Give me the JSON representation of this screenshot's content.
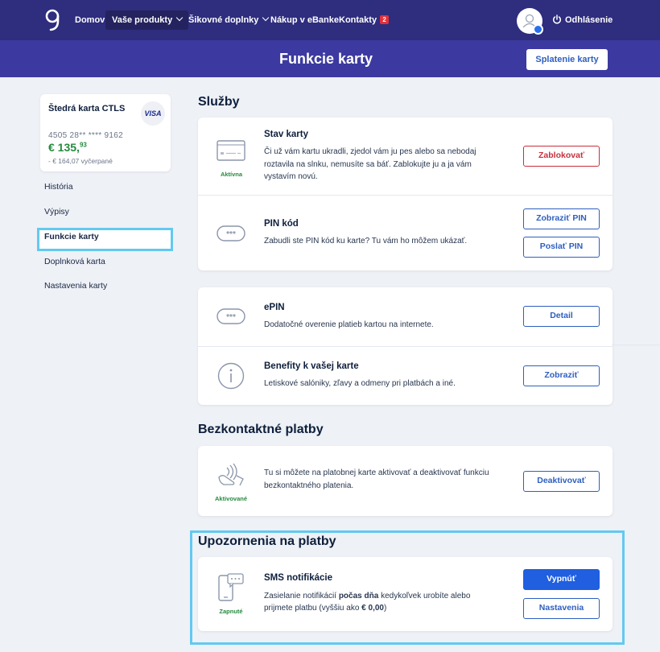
{
  "nav": {
    "items": [
      {
        "label": "Domov"
      },
      {
        "label": "Vaše produkty"
      },
      {
        "label": "Šikovné doplnky"
      },
      {
        "label": "Nákup v eBanke"
      },
      {
        "label": "Kontakty",
        "badge": "2"
      }
    ],
    "logout": "Odhlásenie"
  },
  "header": {
    "title": "Funkcie karty",
    "action": "Splatenie karty"
  },
  "card": {
    "name": "Štedrá karta CTLS",
    "brand": "VISA",
    "number": "4505 28** **** 9162",
    "amount_main": "€ 135,",
    "amount_cents": "93",
    "spent": "- € 164,07 vyčerpané"
  },
  "sidebar": {
    "items": [
      {
        "label": "História"
      },
      {
        "label": "Výpisy"
      },
      {
        "label": "Funkcie karty"
      },
      {
        "label": "Doplnková karta"
      },
      {
        "label": "Nastavenia karty"
      }
    ]
  },
  "sections": {
    "sluzby": "Služby",
    "bezkontaktne": "Bezkontaktné platby",
    "upozornenia": "Upozornenia na platby"
  },
  "rows": {
    "stav": {
      "title": "Stav karty",
      "desc1": "Či už vám kartu ukradli, zjedol vám ju pes alebo sa nebodaj",
      "desc2": "roztavila na slnku, nemusíte sa báť. Zablokujte ju a ja vám",
      "desc3": "vystavím novú.",
      "status": "Aktívna",
      "button": "Zablokovať"
    },
    "pin": {
      "title": "PIN kód",
      "desc": "Zabudli ste PIN kód ku karte? Tu vám ho môžem ukázať.",
      "button1": "Zobraziť PIN",
      "button2": "Poslať PIN"
    },
    "epin": {
      "title": "ePIN",
      "desc": "Dodatočné overenie platieb kartou na internete.",
      "button": "Detail"
    },
    "benefity": {
      "title": "Benefity k vašej karte",
      "desc": "Letiskové salóniky, zľavy a odmeny pri platbách a iné.",
      "button": "Zobraziť"
    },
    "contactless": {
      "desc1": "Tu si môžete na platobnej karte aktivovať a deaktivovať funkciu",
      "desc2": "bezkontaktného platenia.",
      "status": "Aktivované",
      "button": "Deaktivovať"
    },
    "sms": {
      "title": "SMS notifikácie",
      "desc1a": "Zasielanie notifikácií ",
      "desc1b": "počas dňa",
      "desc1c": " kedykoľvek urobíte alebo",
      "desc2a": "prijmete platbu (vyššiu ako ",
      "desc2b": "€ 0,00",
      "desc2c": ")",
      "status": "Zapnuté",
      "button1": "Vypnúť",
      "button2": "Nastavenia"
    }
  },
  "colors": {
    "nav": "#2e2d7e",
    "band": "#3c3aa0",
    "primary": "#2e5fbf",
    "danger": "#c8303a",
    "success": "#248a3d",
    "highlight": "#62c9f0"
  }
}
